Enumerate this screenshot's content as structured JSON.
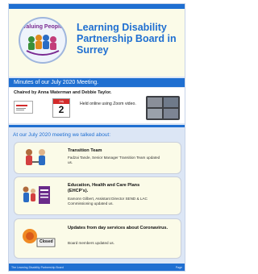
{
  "header": {
    "logo_text": "Valuing People",
    "title": "Learning Disability Partnership Board in Surrey"
  },
  "minutes_bar": "Minutes of our July 2020 Meeting.",
  "meeting": {
    "chaired_by": "Chaired by Anna Waterman and Debbie Taylor.",
    "calendar_month": "July",
    "calendar_day": "2",
    "held_online": "Held online using Zoom video."
  },
  "talked_about_heading": "At our July 2020 meeting we talked about:",
  "topics": [
    {
      "title": "Transition Team",
      "description": "Fadzai Tande, Senior Manager Transition Team updated us."
    },
    {
      "title": "Education, Health and Care Plans (EHCP's).",
      "description": "Eamonn Gilbert, Assistant Director SEND & LAC Commissioning updated us."
    },
    {
      "title": "Updates from day services about Coronavirus.",
      "description": "Board members updated us."
    }
  ],
  "footer": {
    "left_text": "The Learning Disability Partnership Board",
    "right_text": "Page"
  },
  "colors": {
    "brand_blue": "#1f6fd1",
    "header_bg": "#fbfbe8",
    "page_bg": "#dce6f5"
  }
}
